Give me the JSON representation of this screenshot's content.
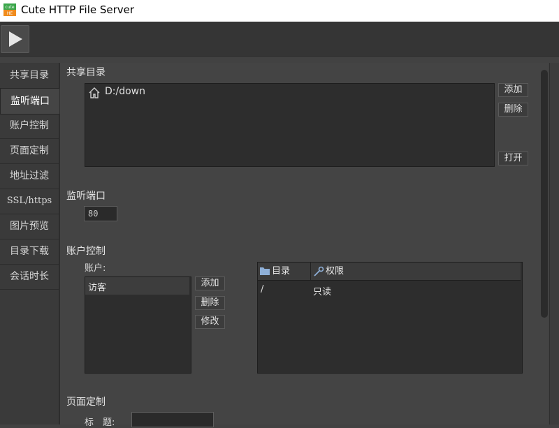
{
  "app": {
    "title": "Cute HTTP File Server",
    "icon_top_text": "cute",
    "icon_bottom_text": "HE"
  },
  "toolbar": {
    "play_icon": "play-icon"
  },
  "nav": {
    "items": [
      {
        "label": "共享目录",
        "active": false
      },
      {
        "label": "监听端口",
        "active": true
      },
      {
        "label": "账户控制",
        "active": false
      },
      {
        "label": "页面定制",
        "active": false
      },
      {
        "label": "地址过滤",
        "active": false
      },
      {
        "label": "SSL/https",
        "active": false
      },
      {
        "label": "图片预览",
        "active": false
      },
      {
        "label": "目录下载",
        "active": false
      },
      {
        "label": "会话时长",
        "active": false
      }
    ]
  },
  "shared_dir": {
    "title": "共享目录",
    "entries": [
      {
        "icon": "home-icon",
        "path": "D:/down"
      }
    ],
    "add_label": "添加",
    "delete_label": "删除",
    "open_label": "打开"
  },
  "listen_port": {
    "title": "监听端口",
    "value": "80"
  },
  "accounts": {
    "title": "账户控制",
    "account_label": "账户:",
    "users": [
      "访客"
    ],
    "add_label": "添加",
    "delete_label": "删除",
    "modify_label": "修改",
    "table": {
      "columns": [
        {
          "label": "目录",
          "icon": "folder-icon"
        },
        {
          "label": "权限",
          "icon": "key-icon"
        }
      ],
      "rows": [
        [
          "/",
          "只读"
        ]
      ]
    }
  },
  "page_custom": {
    "title": "页面定制",
    "title_label": "标　题:",
    "title_value": ""
  },
  "colors": {
    "background": "#424242",
    "panel": "#2d2d2d",
    "icon_orange": "#f08c1e",
    "icon_green": "#3aa64a"
  }
}
